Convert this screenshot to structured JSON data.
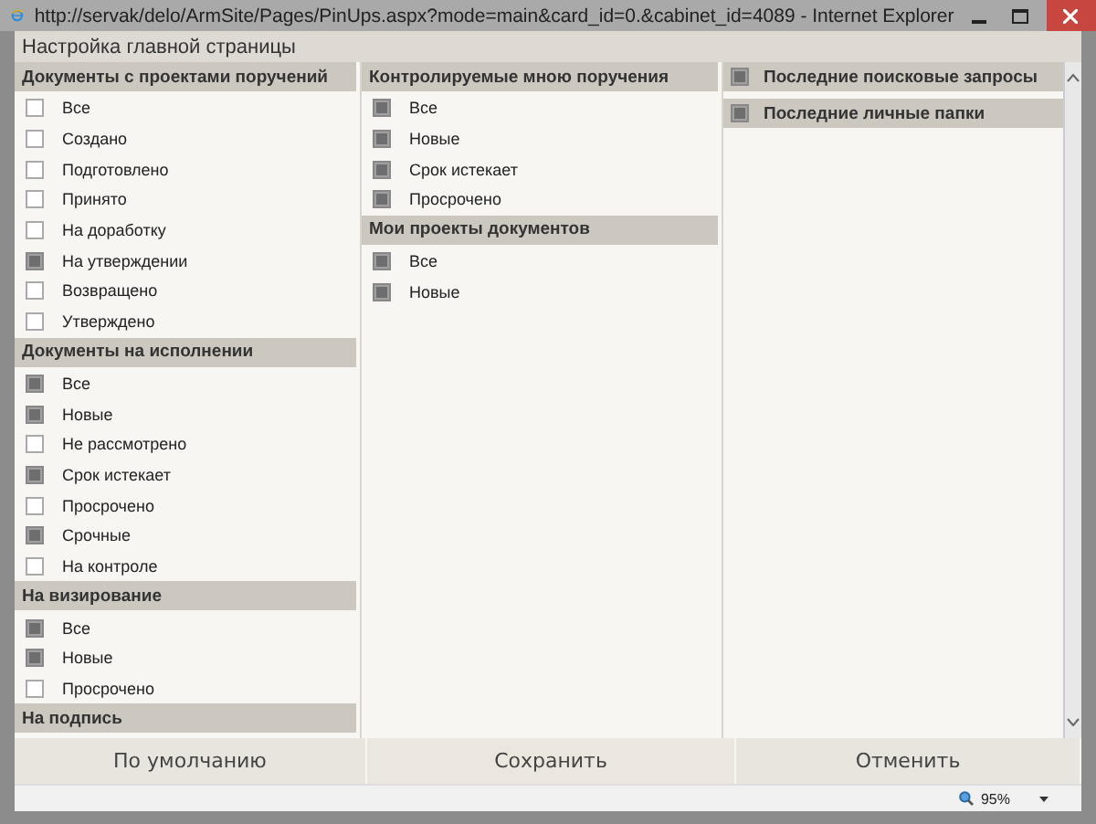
{
  "window": {
    "title": "http://servak/delo/ArmSite/Pages/PinUps.aspx?mode=main&card_id=0.&cabinet_id=4089 - Internet Explorer"
  },
  "page_title": "Настройка главной страницы",
  "columns": [
    {
      "sections": [
        {
          "kind": "list",
          "title": "Документы с проектами поручений",
          "items": [
            {
              "label": "Все",
              "checked": false
            },
            {
              "label": "Создано",
              "checked": false
            },
            {
              "label": "Подготовлено",
              "checked": false
            },
            {
              "label": "Принято",
              "checked": false
            },
            {
              "label": "На доработку",
              "checked": false
            },
            {
              "label": "На утверждении",
              "checked": true
            },
            {
              "label": "Возвращено",
              "checked": false
            },
            {
              "label": "Утверждено",
              "checked": false
            }
          ]
        },
        {
          "kind": "list",
          "title": "Документы на исполнении",
          "items": [
            {
              "label": "Все",
              "checked": true
            },
            {
              "label": "Новые",
              "checked": true
            },
            {
              "label": "Не рассмотрено",
              "checked": false
            },
            {
              "label": "Срок истекает",
              "checked": true
            },
            {
              "label": "Просрочено",
              "checked": false
            },
            {
              "label": "Срочные",
              "checked": true
            },
            {
              "label": "На контроле",
              "checked": false
            }
          ]
        },
        {
          "kind": "list",
          "title": "На визирование",
          "items": [
            {
              "label": "Все",
              "checked": true
            },
            {
              "label": "Новые",
              "checked": true
            },
            {
              "label": "Просрочено",
              "checked": false
            }
          ]
        },
        {
          "kind": "list",
          "title": "На подпись"
        }
      ]
    },
    {
      "sections": [
        {
          "kind": "list",
          "title": "Контролируемые мною поручения",
          "items": [
            {
              "label": "Все",
              "checked": true
            },
            {
              "label": "Новые",
              "checked": true
            },
            {
              "label": "Срок истекает",
              "checked": true
            },
            {
              "label": "Просрочено",
              "checked": true
            }
          ]
        },
        {
          "kind": "list",
          "title": "Мои проекты документов",
          "items": [
            {
              "label": "Все",
              "checked": true
            },
            {
              "label": "Новые",
              "checked": true
            }
          ]
        }
      ]
    },
    {
      "sections": [
        {
          "kind": "toggle",
          "title": "Последние поисковые запросы",
          "checked": true
        },
        {
          "kind": "toggle",
          "title": "Последние личные папки",
          "checked": true
        }
      ]
    }
  ],
  "buttons": [
    "По умолчанию",
    "Сохранить",
    "Отменить"
  ],
  "status_bar": {
    "zoom": "95%"
  }
}
